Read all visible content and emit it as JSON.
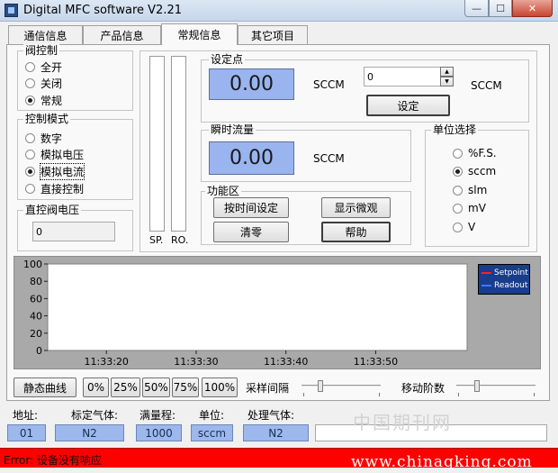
{
  "window": {
    "title": "Digital MFC software  V2.21",
    "min_glyph": "—",
    "max_glyph": "☐",
    "close_glyph": "✕"
  },
  "tabs": [
    {
      "label": "通信信息"
    },
    {
      "label": "产品信息"
    },
    {
      "label": "常规信息"
    },
    {
      "label": "其它项目"
    }
  ],
  "valve_control": {
    "title": "阀控制",
    "options": [
      "全开",
      "关闭",
      "常规"
    ],
    "selected": "常规"
  },
  "control_mode": {
    "title": "控制模式",
    "options": [
      "数字",
      "模拟电压",
      "模拟电流",
      "直接控制"
    ],
    "selected": "模拟电流"
  },
  "direct_valve_voltage": {
    "title": "直控阀电压",
    "value": "0"
  },
  "bars": {
    "sp_label": "SP.",
    "ro_label": "RO."
  },
  "setpoint": {
    "title": "设定点",
    "display_value": "0.00",
    "display_unit": "SCCM",
    "input_value": "0",
    "input_unit": "SCCM",
    "set_button": "设定",
    "up_glyph": "▲",
    "down_glyph": "▼"
  },
  "instant_flow": {
    "title": "瞬时流量",
    "display_value": "0.00",
    "display_unit": "SCCM"
  },
  "function_area": {
    "title": "功能区",
    "buttons": [
      "按时间设定",
      "显示微观",
      "清零",
      "帮助"
    ]
  },
  "unit_select": {
    "title": "单位选择",
    "options": [
      "%F.S.",
      "sccm",
      "slm",
      "mV",
      "V"
    ],
    "selected": "sccm"
  },
  "chart_data": {
    "type": "line",
    "y_ticks": [
      100,
      80,
      60,
      40,
      20,
      0
    ],
    "ylim": [
      0,
      100
    ],
    "x_ticks": [
      "11:33:20",
      "11:33:30",
      "11:33:40",
      "11:33:50"
    ],
    "series": [
      {
        "name": "Setpoint",
        "color": "#ff0000",
        "values": []
      },
      {
        "name": "Readout",
        "color": "#3a7bff",
        "values": []
      }
    ],
    "grid": false,
    "legend": "top-right",
    "background": "#ffffff"
  },
  "controls": {
    "static_curve_button": "静态曲线",
    "percent_buttons": [
      "0%",
      "25%",
      "50%",
      "75%",
      "100%"
    ],
    "sample_interval_label": "采样间隔",
    "moving_order_label": "移动阶数"
  },
  "info": {
    "labels": [
      "地址:",
      "标定气体:",
      "满量程:",
      "单位:",
      "处理气体:"
    ],
    "address": "01",
    "calib_gas": "N2",
    "full_scale": "1000",
    "unit": "sccm",
    "process_gas": "N2"
  },
  "watermark": {
    "cn": "中国期刊网",
    "url": "www.chinaqking.com"
  },
  "status": {
    "text": "Error: 设备没有响应",
    "color": "#ff0000"
  }
}
